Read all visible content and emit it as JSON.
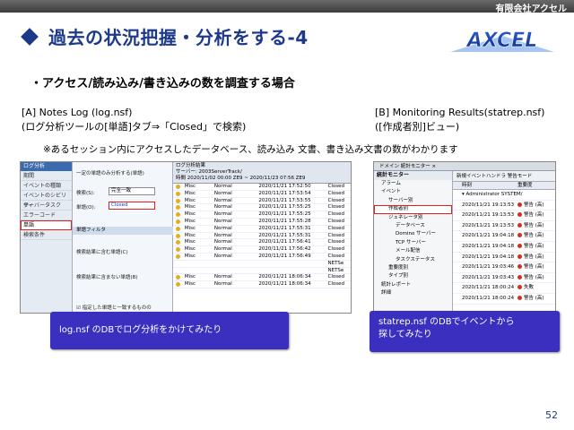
{
  "header": {
    "company": "有限会社アクセル"
  },
  "slide": {
    "title": "過去の状況把握・分析をする-4",
    "subtitle": "・アクセス/読み込み/書き込みの数を調査する場合",
    "a_label_line1": "[A] Notes Log (log.nsf)",
    "a_label_line2": "(ログ分析ツールの[単語]タブ⇒「Closed」で検索)",
    "b_label_line1": "[B] Monitoring Results(statrep.nsf)",
    "b_label_line2": "([作成者別]ビュー)",
    "note": "※あるセッション内にアクセスしたデータベース、読み込み 文書、書き込み文書の数がわかります",
    "page_number": "52"
  },
  "logo": {
    "text": "AXCEL"
  },
  "screenshot_a": {
    "nav_title": "ログ分析",
    "nav_items": [
      "期間",
      "イベントの種類",
      "イベントのシビリティ",
      "サーバータスク",
      "エラーコード",
      "単語",
      "検索条件"
    ],
    "nav_selected": 5,
    "mid_row1": "一定の単語のみ分析する(単語)",
    "mid_search_label": "検索(S):",
    "mid_search_value": "完全一致",
    "mid_word_label": "単語(O):",
    "mid_word_value": "Closed",
    "mid_band1": "単語フィルタ",
    "mid_row_include": "検索結果に含む単語(C)",
    "mid_row_exclude": "検索結果に含まない単語(B)",
    "mid_band2": "指定した単語と一致するものの",
    "grid_head1": "ログ分析結果",
    "grid_head2": "サーバー: 2003ServerTrack/",
    "grid_head3": "時間 2020/11/02 00:00 ZE9 ~ 2020/11/23 07:56 ZE9",
    "rows": [
      {
        "type": "Misc",
        "level": "Normal",
        "time": "2020/11/21 17:52:50",
        "text": "Closed"
      },
      {
        "type": "Misc",
        "level": "Normal",
        "time": "2020/11/21 17:53:54",
        "text": "Closed"
      },
      {
        "type": "Misc",
        "level": "Normal",
        "time": "2020/11/21 17:53:55",
        "text": "Closed"
      },
      {
        "type": "Misc",
        "level": "Normal",
        "time": "2020/11/21 17:55:25",
        "text": "Closed"
      },
      {
        "type": "Misc",
        "level": "Normal",
        "time": "2020/11/21 17:55:25",
        "text": "Closed"
      },
      {
        "type": "Misc",
        "level": "Normal",
        "time": "2020/11/21 17:55:28",
        "text": "Closed"
      },
      {
        "type": "Misc",
        "level": "Normal",
        "time": "2020/11/21 17:55:31",
        "text": "Closed"
      },
      {
        "type": "Misc",
        "level": "Normal",
        "time": "2020/11/21 17:55:31",
        "text": "Closed"
      },
      {
        "type": "Misc",
        "level": "Normal",
        "time": "2020/11/21 17:56:41",
        "text": "Closed"
      },
      {
        "type": "Misc",
        "level": "Normal",
        "time": "2020/11/21 17:56:42",
        "text": "Closed"
      },
      {
        "type": "Misc",
        "level": "Normal",
        "time": "2020/11/21 17:56:49",
        "text": "Closed"
      },
      {
        "type": "",
        "level": "",
        "time": "",
        "text": "NETSe"
      },
      {
        "type": "",
        "level": "",
        "time": "",
        "text": "NETSe"
      },
      {
        "type": "Misc",
        "level": "Normal",
        "time": "2020/11/21 18:06:34",
        "text": "Closed"
      },
      {
        "type": "Misc",
        "level": "Normal",
        "time": "2020/11/21 18:06:34",
        "text": "Closed"
      }
    ]
  },
  "screenshot_b": {
    "tabs": "ドメイン 統計モニター ×",
    "panel_title": "統計モニター",
    "toolbar": "新規イベントハンドラ  警告モード",
    "col_time": "時刻",
    "col_sev": "重要度",
    "tree": [
      {
        "label": "アラーム",
        "indent": 1,
        "selected": false
      },
      {
        "label": "イベント",
        "indent": 1,
        "selected": false
      },
      {
        "label": "サーバー別",
        "indent": 2,
        "selected": false
      },
      {
        "label": "作成者別",
        "indent": 2,
        "selected": true
      },
      {
        "label": "ジェネレータ別",
        "indent": 2,
        "selected": false
      },
      {
        "label": "データベース",
        "indent": 3,
        "selected": false
      },
      {
        "label": "Domino サーバー",
        "indent": 3,
        "selected": false
      },
      {
        "label": "TCP サーバー",
        "indent": 3,
        "selected": false
      },
      {
        "label": "メール配信",
        "indent": 3,
        "selected": false
      },
      {
        "label": "タスクステータス",
        "indent": 3,
        "selected": false
      },
      {
        "label": "重要度別",
        "indent": 2,
        "selected": false
      },
      {
        "label": "タイプ別",
        "indent": 2,
        "selected": false
      },
      {
        "label": "統計レポート",
        "indent": 1,
        "selected": false
      },
      {
        "label": "詳細",
        "indent": 1,
        "selected": false
      }
    ],
    "rows": [
      {
        "time": "▾ Administrator SYSTEM/",
        "sev": ""
      },
      {
        "time": "2020/11/21 19:13:53",
        "sev": "警告 (高)"
      },
      {
        "time": "2020/11/21 19:13:53",
        "sev": "警告 (高)"
      },
      {
        "time": "2020/11/21 19:13:53",
        "sev": "警告 (高)"
      },
      {
        "time": "2020/11/21 19:04:18",
        "sev": "警告 (高)"
      },
      {
        "time": "2020/11/21 19:04:18",
        "sev": "警告 (高)"
      },
      {
        "time": "2020/11/21 19:04:18",
        "sev": "警告 (高)"
      },
      {
        "time": "2020/11/21 19:03:46",
        "sev": "警告 (高)"
      },
      {
        "time": "2020/11/21 19:03:43",
        "sev": "警告 (高)"
      },
      {
        "time": "2020/11/21 18:00:24",
        "sev": "失敗"
      },
      {
        "time": "2020/11/21 18:00:24",
        "sev": "警告 (高)"
      }
    ]
  },
  "callouts": {
    "a": "log.nsf のDBでログ分析をかけてみたり",
    "b_line1": "statrep.nsf のDBでイベントから",
    "b_line2": "探してみたり"
  }
}
